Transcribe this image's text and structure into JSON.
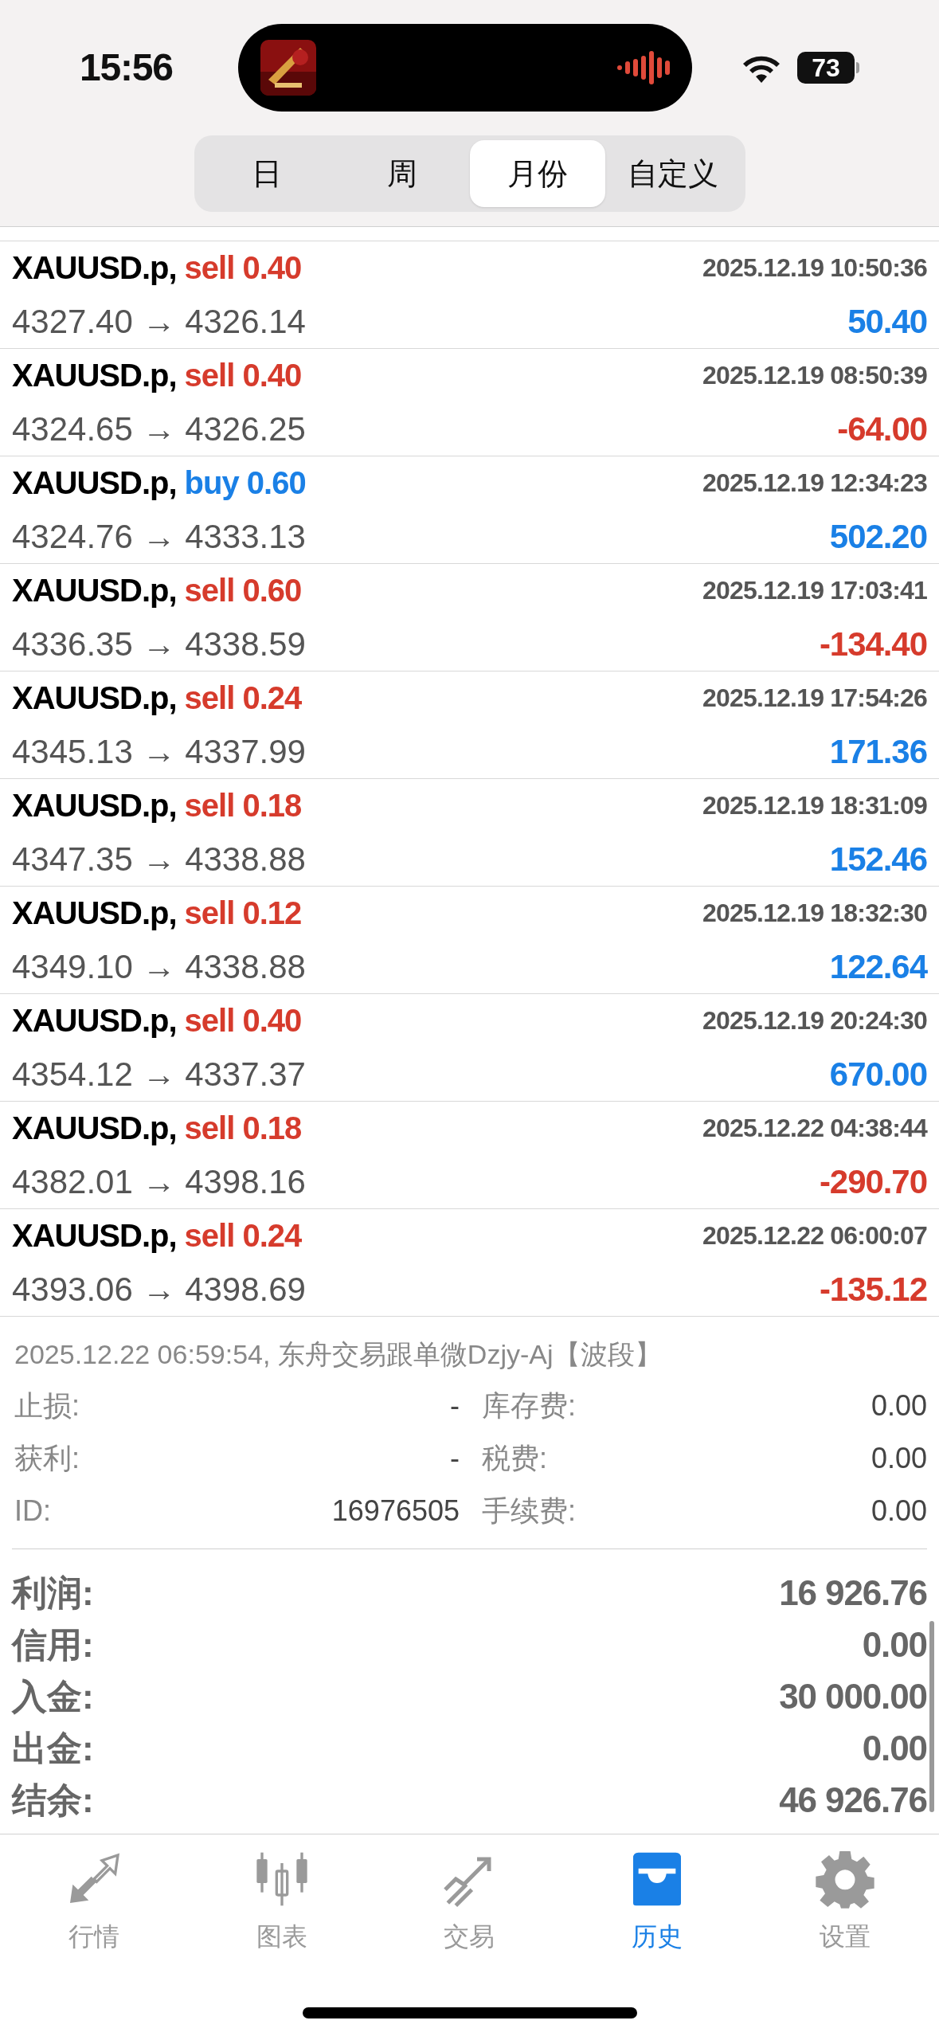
{
  "status_bar": {
    "time": "15:56",
    "battery": "73"
  },
  "period_tabs": [
    {
      "label": "日",
      "selected": false
    },
    {
      "label": "周",
      "selected": false
    },
    {
      "label": "月份",
      "selected": true
    },
    {
      "label": "自定义",
      "selected": false
    }
  ],
  "trades": [
    {
      "symbol": "XAUUSD.p,",
      "order": "sell 0.40",
      "kind": "sell",
      "time": "2025.12.19 10:50:36",
      "prices": "4327.40 → 4326.14",
      "profit": "50.40",
      "color": "#1a80e6"
    },
    {
      "symbol": "XAUUSD.p,",
      "order": "sell 0.40",
      "kind": "sell",
      "time": "2025.12.19 08:50:39",
      "prices": "4324.65 → 4326.25",
      "profit": "-64.00",
      "color": "#d63b2c"
    },
    {
      "symbol": "XAUUSD.p,",
      "order": "buy 0.60",
      "kind": "buy",
      "time": "2025.12.19 12:34:23",
      "prices": "4324.76 → 4333.13",
      "profit": "502.20",
      "color": "#1a80e6"
    },
    {
      "symbol": "XAUUSD.p,",
      "order": "sell 0.60",
      "kind": "sell",
      "time": "2025.12.19 17:03:41",
      "prices": "4336.35 → 4338.59",
      "profit": "-134.40",
      "color": "#d63b2c"
    },
    {
      "symbol": "XAUUSD.p,",
      "order": "sell 0.24",
      "kind": "sell",
      "time": "2025.12.19 17:54:26",
      "prices": "4345.13 → 4337.99",
      "profit": "171.36",
      "color": "#1a80e6"
    },
    {
      "symbol": "XAUUSD.p,",
      "order": "sell 0.18",
      "kind": "sell",
      "time": "2025.12.19 18:31:09",
      "prices": "4347.35 → 4338.88",
      "profit": "152.46",
      "color": "#1a80e6"
    },
    {
      "symbol": "XAUUSD.p,",
      "order": "sell 0.12",
      "kind": "sell",
      "time": "2025.12.19 18:32:30",
      "prices": "4349.10 → 4338.88",
      "profit": "122.64",
      "color": "#1a80e6"
    },
    {
      "symbol": "XAUUSD.p,",
      "order": "sell 0.40",
      "kind": "sell",
      "time": "2025.12.19 20:24:30",
      "prices": "4354.12 → 4337.37",
      "profit": "670.00",
      "color": "#1a80e6"
    },
    {
      "symbol": "XAUUSD.p,",
      "order": "sell 0.18",
      "kind": "sell",
      "time": "2025.12.22 04:38:44",
      "prices": "4382.01 → 4398.16",
      "profit": "-290.70",
      "color": "#d63b2c"
    },
    {
      "symbol": "XAUUSD.p,",
      "order": "sell 0.24",
      "kind": "sell",
      "time": "2025.12.22 06:00:07",
      "prices": "4393.06 → 4398.69",
      "profit": "-135.12",
      "color": "#d63b2c"
    }
  ],
  "detail": {
    "comment": "2025.12.22 06:59:54, 东舟交易跟单微Dzjy-Aj【波段】",
    "fields": [
      {
        "label": "止损:",
        "value": "-",
        "label_2": "库存费:",
        "value_2": "0.00"
      },
      {
        "label": "获利:",
        "value": "-",
        "label_2": "税费:",
        "value_2": "0.00"
      },
      {
        "label": "ID:",
        "value": "16976505",
        "label_2": "手续费:",
        "value_2": "0.00"
      }
    ]
  },
  "summary": [
    {
      "label": "利润:",
      "value": "16 926.76"
    },
    {
      "label": "信用:",
      "value": "0.00"
    },
    {
      "label": "入金:",
      "value": "30 000.00"
    },
    {
      "label": "出金:",
      "value": "0.00"
    },
    {
      "label": "结余:",
      "value": "46 926.76"
    }
  ],
  "tab_bar": [
    {
      "label": "行情",
      "selected": false
    },
    {
      "label": "图表",
      "selected": false
    },
    {
      "label": "交易",
      "selected": false
    },
    {
      "label": "历史",
      "selected": true
    },
    {
      "label": "设置",
      "selected": false
    }
  ]
}
